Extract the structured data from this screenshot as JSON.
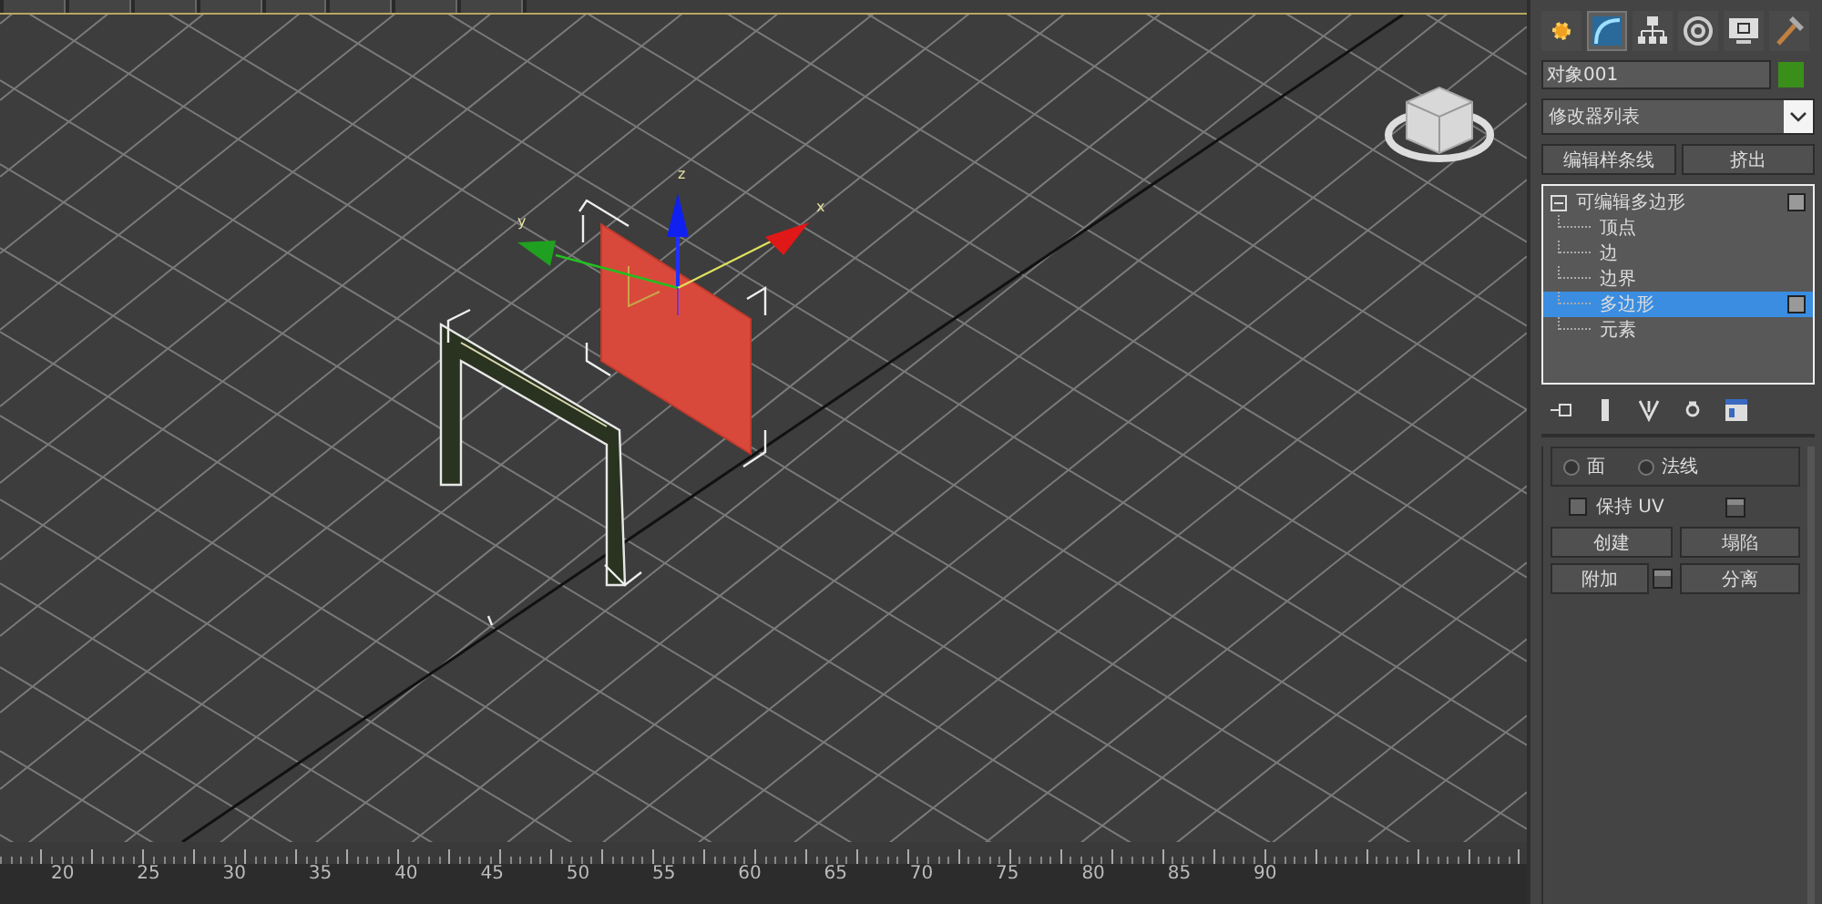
{
  "viewport": {
    "gizmo_axes": [
      {
        "label": "x"
      },
      {
        "label": "y"
      },
      {
        "label": "z"
      }
    ]
  },
  "command_panel": {
    "tabs": [
      {
        "kind": "create",
        "selected": false
      },
      {
        "kind": "modify",
        "selected": true
      },
      {
        "kind": "hierarchy",
        "selected": false
      },
      {
        "kind": "motion",
        "selected": false
      },
      {
        "kind": "display",
        "selected": false
      },
      {
        "kind": "utilities",
        "selected": false
      }
    ],
    "object_name": "对象001",
    "modifier_list": "修改器列表",
    "quick_buttons": [
      "编辑样条线",
      "挤出"
    ],
    "stack": [
      {
        "label": "可编辑多边形",
        "expanded": true,
        "selected": false,
        "children": [
          {
            "label": "顶点",
            "selected": false
          },
          {
            "label": "边",
            "selected": false
          },
          {
            "label": "边界",
            "selected": false
          },
          {
            "label": "多边形",
            "selected": true
          },
          {
            "label": "元素",
            "selected": false
          }
        ]
      }
    ],
    "stack_tools": [
      {
        "kind": "pin"
      },
      {
        "kind": "show-result"
      },
      {
        "kind": "make-unique"
      },
      {
        "kind": "remove"
      },
      {
        "kind": "configure"
      }
    ],
    "rollout": {
      "radios": [
        {
          "label": "面",
          "selected": false
        },
        {
          "label": "法线",
          "selected": false
        }
      ],
      "checkbox": {
        "label": "保持 UV",
        "checked": false
      },
      "buttons": [
        {
          "label": "创建",
          "kind": "plain"
        },
        {
          "label": "塌陷",
          "kind": "plain"
        },
        {
          "label": "附加",
          "kind": "settings"
        },
        {
          "label": "分离",
          "kind": "plain"
        }
      ]
    }
  },
  "timeline": {
    "ticks": [
      "20",
      "25",
      "30",
      "35",
      "40",
      "45",
      "50",
      "55",
      "60",
      "65",
      "70",
      "75",
      "80",
      "85",
      "90"
    ]
  }
}
